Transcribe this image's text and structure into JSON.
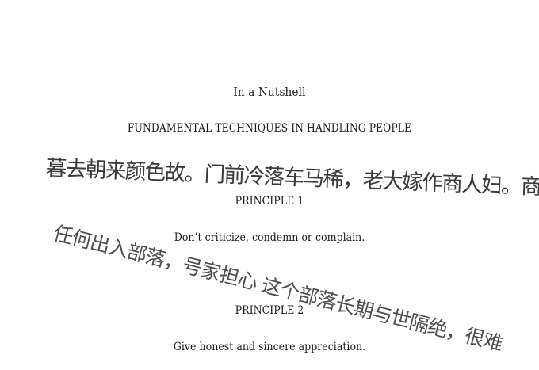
{
  "document": {
    "title": "In a Nutshell",
    "subtitle": "FUNDAMENTAL TECHNIQUES IN HANDLING PEOPLE",
    "principles": [
      {
        "heading": "PRINCIPLE 1",
        "text": "Don’t criticize, condemn or complain."
      },
      {
        "heading": "PRINCIPLE 2",
        "text": "Give honest and sincere appreciation."
      }
    ]
  },
  "handwriting": [
    "暮去朝来颜色故。门前冷落车马稀，老大嫁作商人妇。商人重",
    "任何出入部落，号家担心 这个部落长期与世隔绝，很难"
  ],
  "colors": {
    "background": "#ffffff",
    "printed_text": "#1a1a1a",
    "handwriting": "#3a3a3a"
  }
}
